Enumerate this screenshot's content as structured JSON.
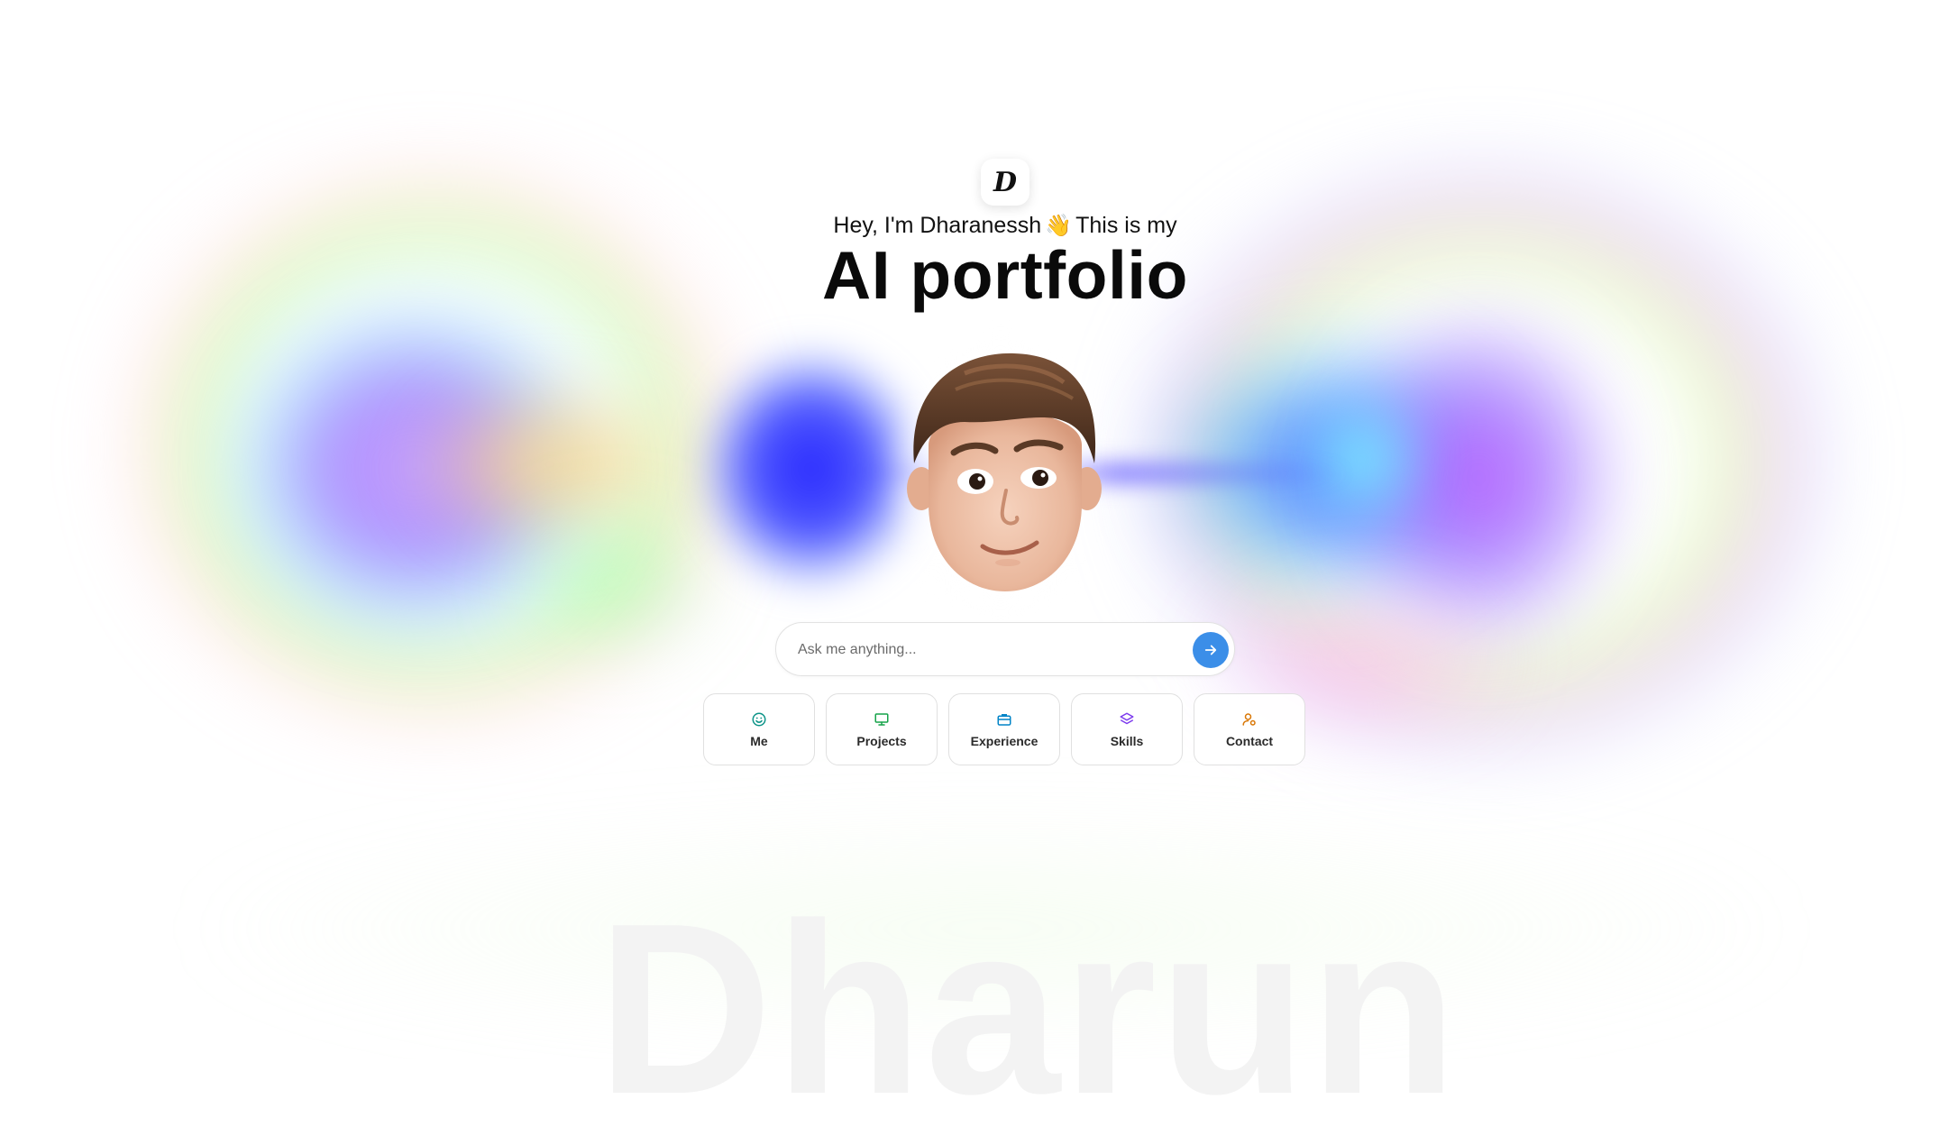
{
  "hero": {
    "logo_letter": "D",
    "greeting": "Hey, I'm Dharanessh",
    "wave_emoji": "👋",
    "greeting_suffix": "This is my",
    "headline": "AI portfolio"
  },
  "search": {
    "placeholder": "Ask me anything...",
    "value": ""
  },
  "nav": {
    "items": [
      {
        "label": "Me",
        "icon": "smile-icon",
        "color": "#0d9488"
      },
      {
        "label": "Projects",
        "icon": "presentation-icon",
        "color": "#16a34a"
      },
      {
        "label": "Experience",
        "icon": "briefcase-icon",
        "color": "#0284c7"
      },
      {
        "label": "Skills",
        "icon": "layers-icon",
        "color": "#7c3aed"
      },
      {
        "label": "Contact",
        "icon": "user-contact-icon",
        "color": "#d97706"
      }
    ]
  },
  "background_name": "Dharun",
  "colors": {
    "accent": "#3b8ee8",
    "text": "#111111"
  }
}
